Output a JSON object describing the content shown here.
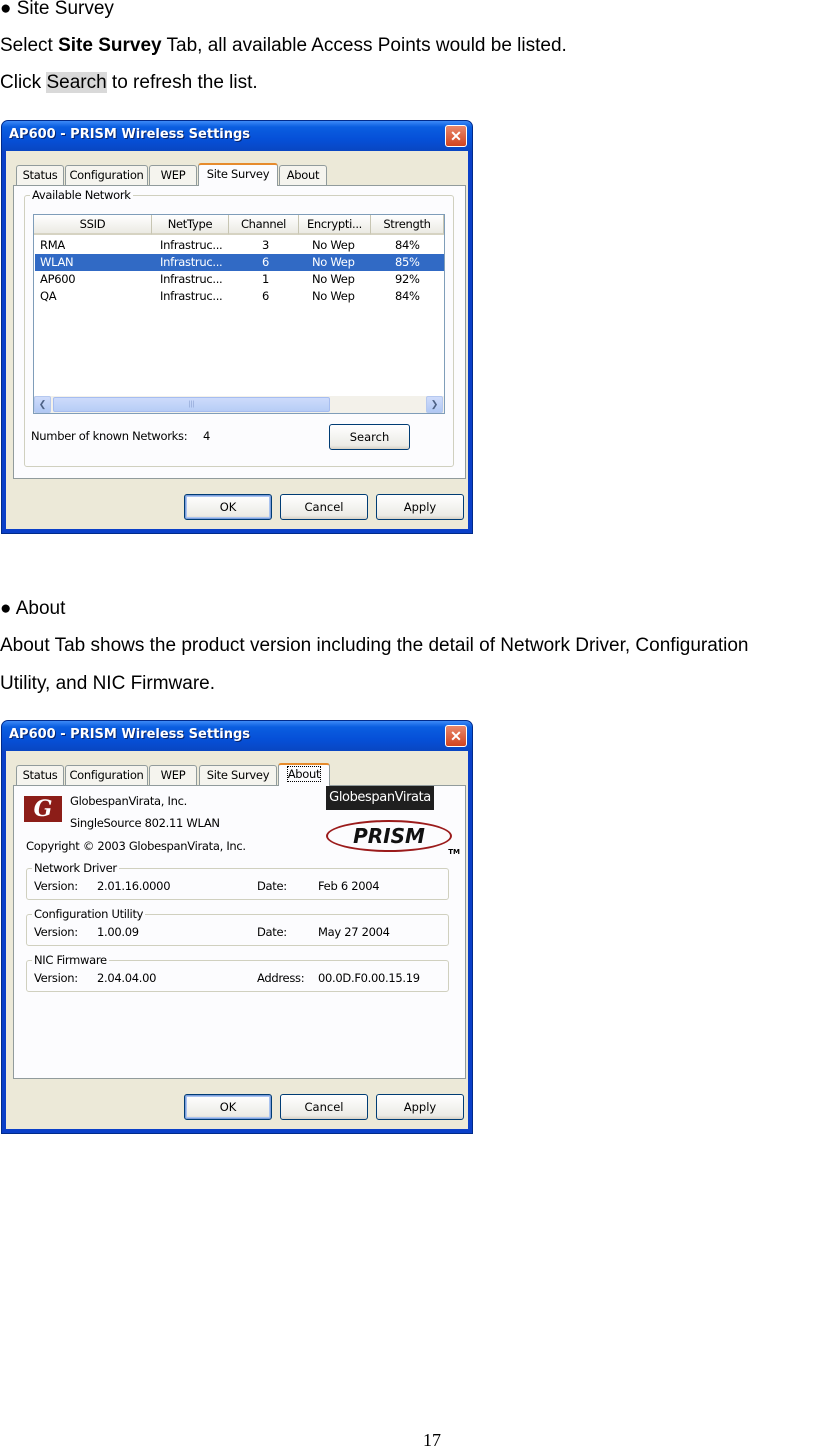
{
  "section1": {
    "bullet": "● Site Survey",
    "line1_pre": "Select ",
    "line1_bold": "Site Survey",
    "line1_post": " Tab, all available Access Points would be listed.",
    "line2_pre": "Click ",
    "line2_hl": "Search",
    "line2_post": " to refresh the list."
  },
  "dialog1": {
    "title": "AP600 - PRISM Wireless Settings",
    "tabs": [
      "Status",
      "Configuration",
      "WEP",
      "Site Survey",
      "About"
    ],
    "group_label": "Available Network",
    "columns": [
      "SSID",
      "NetType",
      "Channel",
      "Encrypti...",
      "Strength"
    ],
    "rows": [
      [
        "RMA",
        "Infrastruc...",
        "3",
        "No Wep",
        "84%"
      ],
      [
        "WLAN",
        "Infrastruc...",
        "6",
        "No Wep",
        "85%"
      ],
      [
        "AP600",
        "Infrastruc...",
        "1",
        "No Wep",
        "92%"
      ],
      [
        "QA",
        "Infrastruc...",
        "6",
        "No Wep",
        "84%"
      ]
    ],
    "known_label": "Number of known Networks:",
    "known_count": "4",
    "search_label": "Search",
    "ok_label": "OK",
    "cancel_label": "Cancel",
    "apply_label": "Apply"
  },
  "section2": {
    "bullet": "● About",
    "line1": "About Tab shows the product version including the detail of Network Driver, Configuration",
    "line2": "Utility, and NIC Firmware."
  },
  "dialog2": {
    "title": "AP600 - PRISM Wireless Settings",
    "tabs": [
      "Status",
      "Configuration",
      "WEP",
      "Site Survey",
      "About"
    ],
    "company": "GlobespanVirata, Inc.",
    "product": "SingleSource 802.11 WLAN",
    "copyright": "Copyright © 2003  GlobespanVirata, Inc.",
    "brand_logo": "GlobespanVirata",
    "prism_logo": "PRISM",
    "tm": "TM",
    "network_driver": {
      "label": "Network Driver",
      "version_label": "Version:",
      "version": "2.01.16.0000",
      "date_label": "Date:",
      "date": "Feb  6 2004"
    },
    "config_utility": {
      "label": "Configuration Utility",
      "version_label": "Version:",
      "version": "1.00.09",
      "date_label": "Date:",
      "date": "May 27 2004"
    },
    "nic_firmware": {
      "label": "NIC Firmware",
      "version_label": "Version:",
      "version": "2.04.04.00",
      "address_label": "Address:",
      "address": "00.0D.F0.00.15.19"
    },
    "ok_label": "OK",
    "cancel_label": "Cancel",
    "apply_label": "Apply"
  },
  "page_number": "17"
}
